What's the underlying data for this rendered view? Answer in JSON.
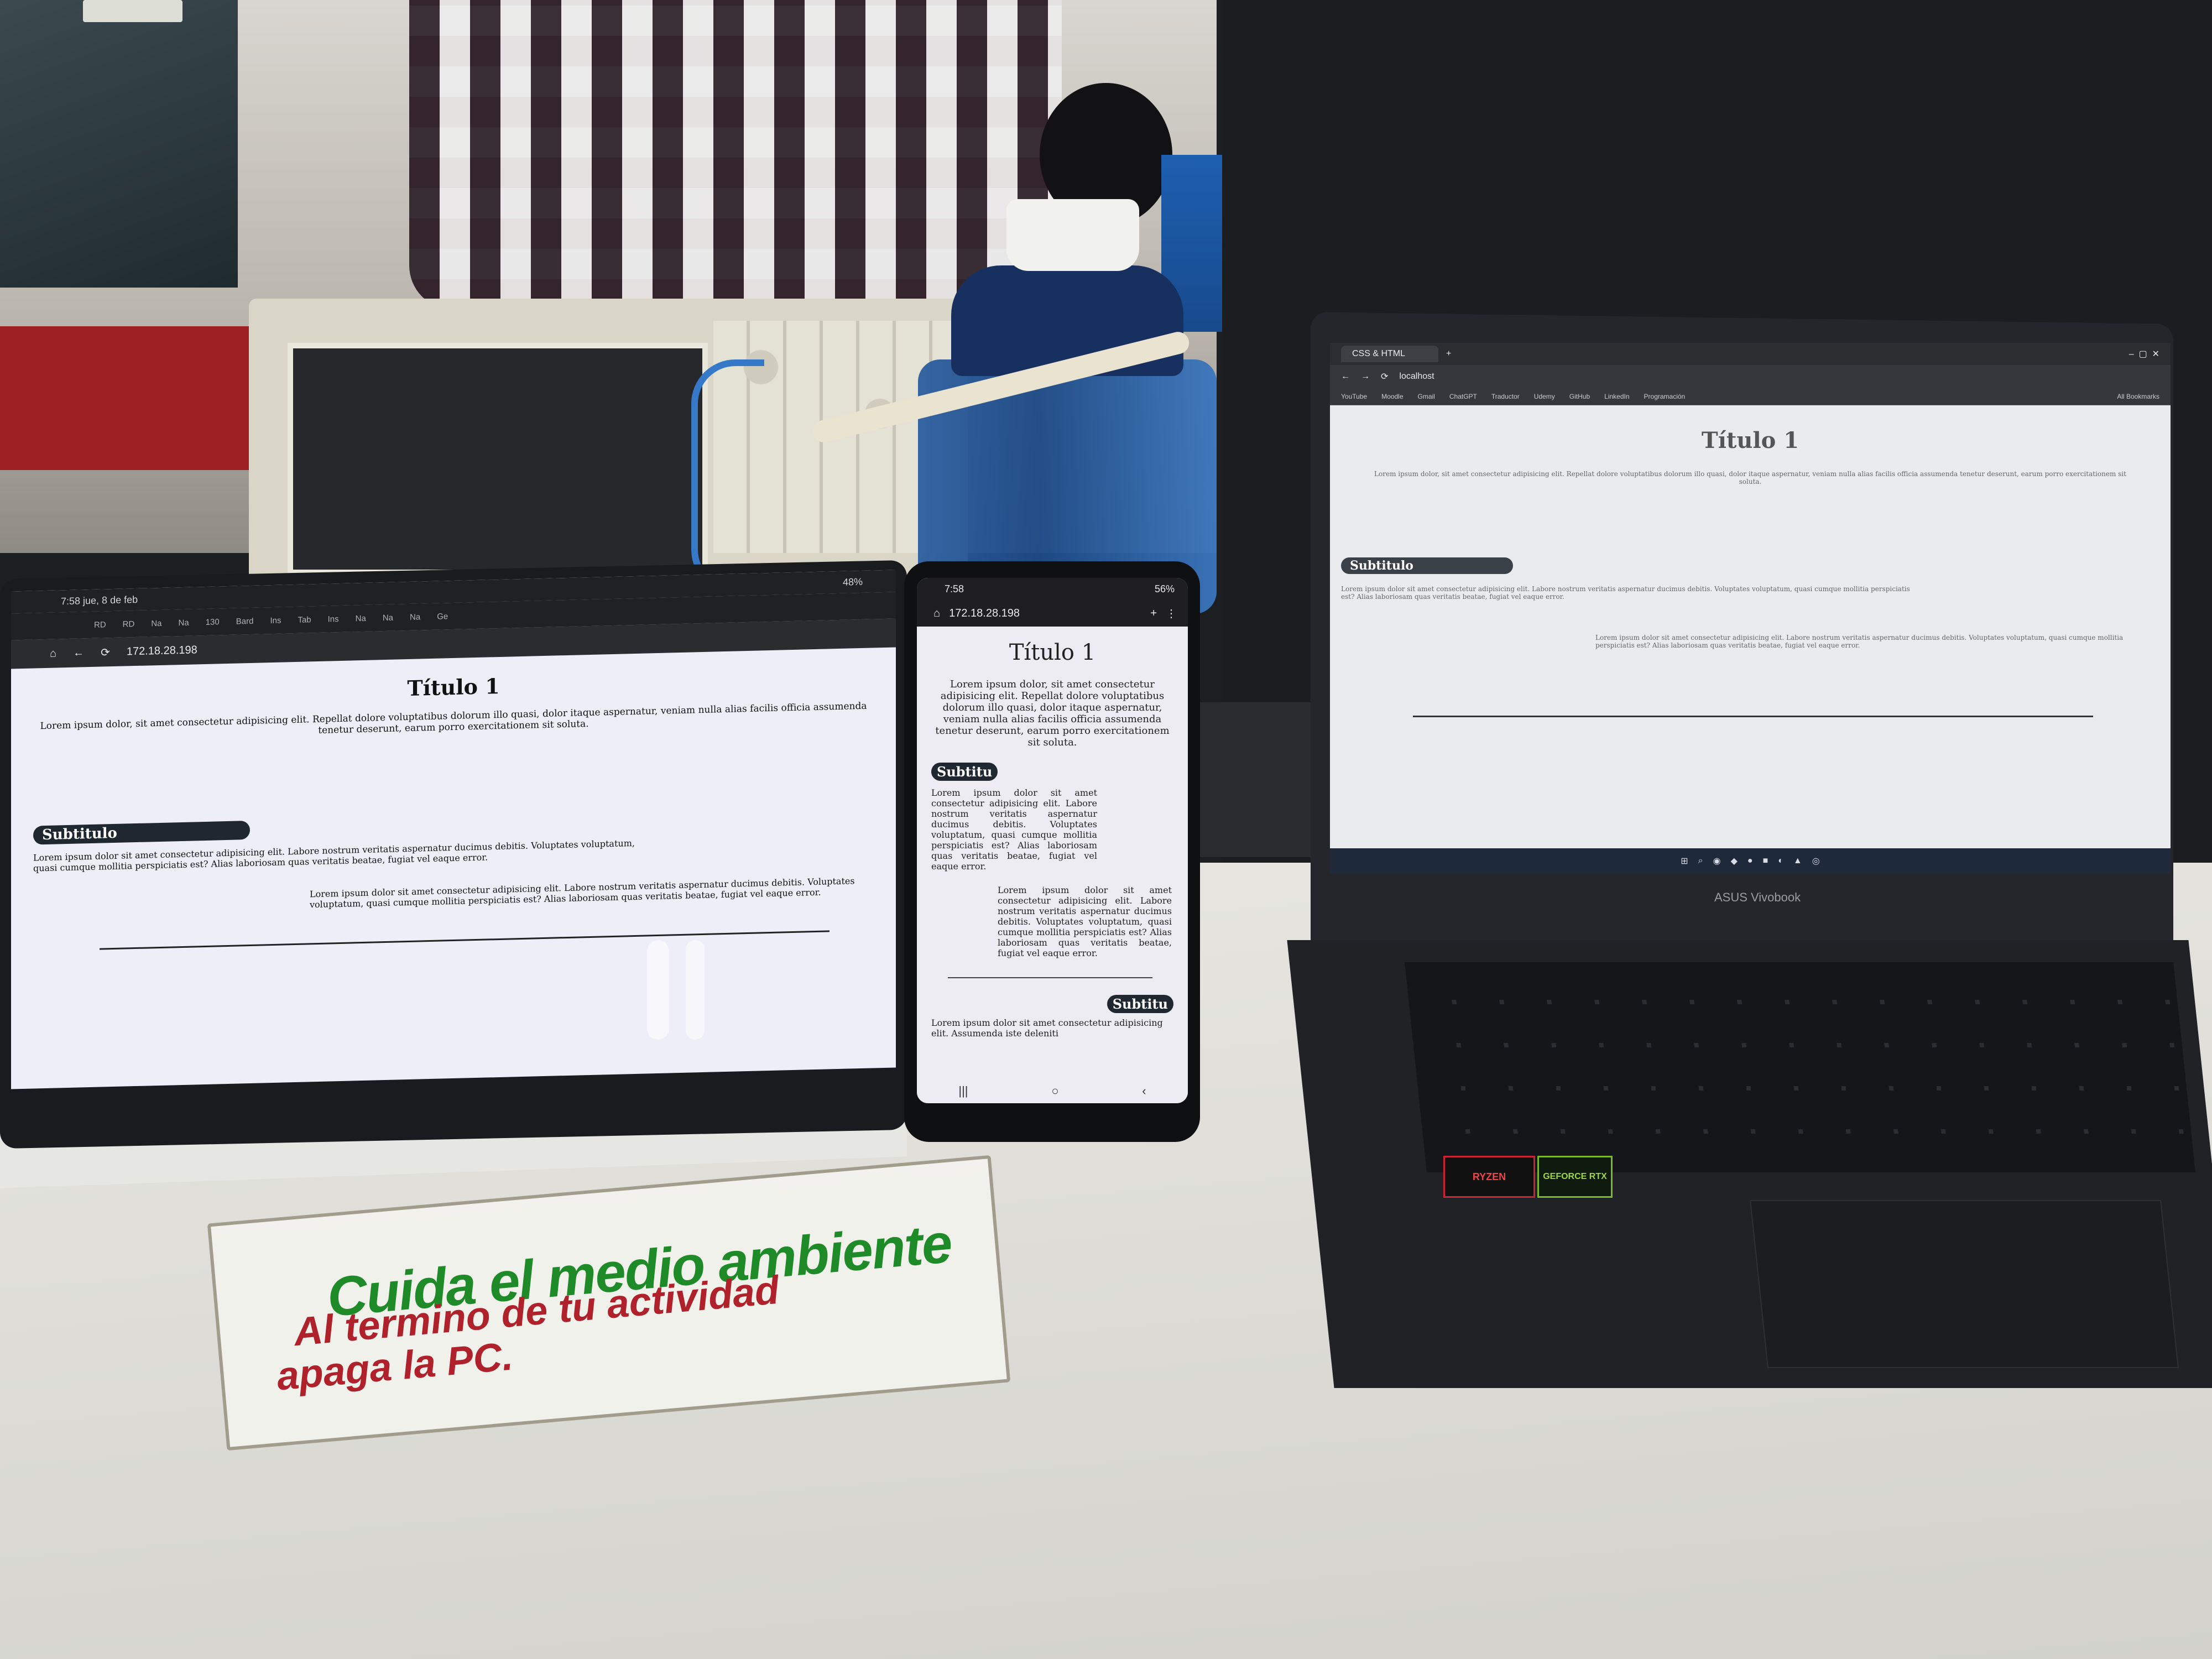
{
  "tablet": {
    "status_time": "7:58  jue, 8 de feb",
    "status_battery": "48%",
    "tabs": [
      "RD",
      "RD",
      "Na",
      "Na",
      "130",
      "Bard",
      "Ins",
      "Tab",
      "Ins",
      "Na",
      "Na",
      "Na",
      "Ge"
    ],
    "url": "172.18.28.198",
    "page": {
      "title": "Título 1",
      "intro": "Lorem ipsum dolor, sit amet consectetur adipisicing elit. Repellat dolore voluptatibus dolorum illo quasi, dolor itaque aspernatur, veniam nulla alias facilis officia assumenda tenetur deserunt, earum porro exercitationem sit soluta.",
      "subtitle": "Subtitulo",
      "para1": "Lorem ipsum dolor sit amet consectetur adipisicing elit. Labore nostrum veritatis aspernatur ducimus debitis. Voluptates voluptatum, quasi cumque mollitia perspiciatis est? Alias laboriosam quas veritatis beatae, fugiat vel eaque error.",
      "para2": "Lorem ipsum dolor sit amet consectetur adipisicing elit. Labore nostrum veritatis aspernatur ducimus debitis. Voluptates voluptatum, quasi cumque mollitia perspiciatis est? Alias laboriosam quas veritatis beatae, fugiat vel eaque error."
    }
  },
  "phone": {
    "status_time": "7:58",
    "status_battery": "56%",
    "url": "172.18.28.198",
    "page": {
      "title": "Título 1",
      "intro": "Lorem ipsum dolor, sit amet consectetur adipisicing elit. Repellat dolore voluptatibus dolorum illo quasi, dolor itaque aspernatur, veniam nulla alias facilis officia assumenda tenetur deserunt, earum porro exercitationem sit soluta.",
      "subtitle": "Subtitu",
      "para1": "Lorem ipsum dolor sit amet consectetur adipisicing elit. Labore nostrum veritatis aspernatur ducimus debitis. Voluptates voluptatum, quasi cumque mollitia perspiciatis est? Alias laboriosam quas veritatis beatae, fugiat vel eaque error.",
      "para2": "Lorem ipsum dolor sit amet consectetur adipisicing elit. Labore nostrum veritatis aspernatur ducimus debitis. Voluptates voluptatum, quasi cumque mollitia perspiciatis est? Alias laboriosam quas veritatis beatae, fugiat vel eaque error.",
      "subtitle2": "Subtitu",
      "para3": "Lorem ipsum dolor sit amet consectetur adipisicing elit. Assumenda iste deleniti"
    }
  },
  "laptop": {
    "tab_title": "CSS & HTML",
    "url": "localhost",
    "bookmarks": [
      "YouTube",
      "Moodle",
      "Gmail",
      "ChatGPT",
      "Traductor",
      "Udemy",
      "GitHub",
      "LinkedIn",
      "Programación",
      "All Bookmarks"
    ],
    "page": {
      "title": "Título 1",
      "intro": "Lorem ipsum dolor, sit amet consectetur adipisicing elit. Repellat dolore voluptatibus dolorum illo quasi, dolor itaque aspernatur, veniam nulla alias facilis officia assumenda tenetur deserunt, earum porro exercitationem sit soluta.",
      "subtitle": "Subtitulo",
      "para1": "Lorem ipsum dolor sit amet consectetur adipisicing elit. Labore nostrum veritatis aspernatur ducimus debitis. Voluptates voluptatum, quasi cumque mollitia perspiciatis est? Alias laboriosam quas veritatis beatae, fugiat vel eaque error.",
      "para2": "Lorem ipsum dolor sit amet consectetur adipisicing elit. Labore nostrum veritatis aspernatur ducimus debitis. Voluptates voluptatum, quasi cumque mollitia perspiciatis est? Alias laboriosam quas veritatis beatae, fugiat vel eaque error."
    },
    "brand": "ASUS Vivobook",
    "sticker_amd": "RYZEN",
    "sticker_nvidia": "GEFORCE RTX"
  },
  "sign": {
    "line1": "Cuida el medio ambiente",
    "line2": "Al termino de tu actividad",
    "line3": "apaga la PC."
  },
  "colors": {
    "sign_green": "#1f8a28",
    "sign_red": "#b0222b",
    "browser_dark": "#202124",
    "subtitle_pill": "#1f2730"
  }
}
